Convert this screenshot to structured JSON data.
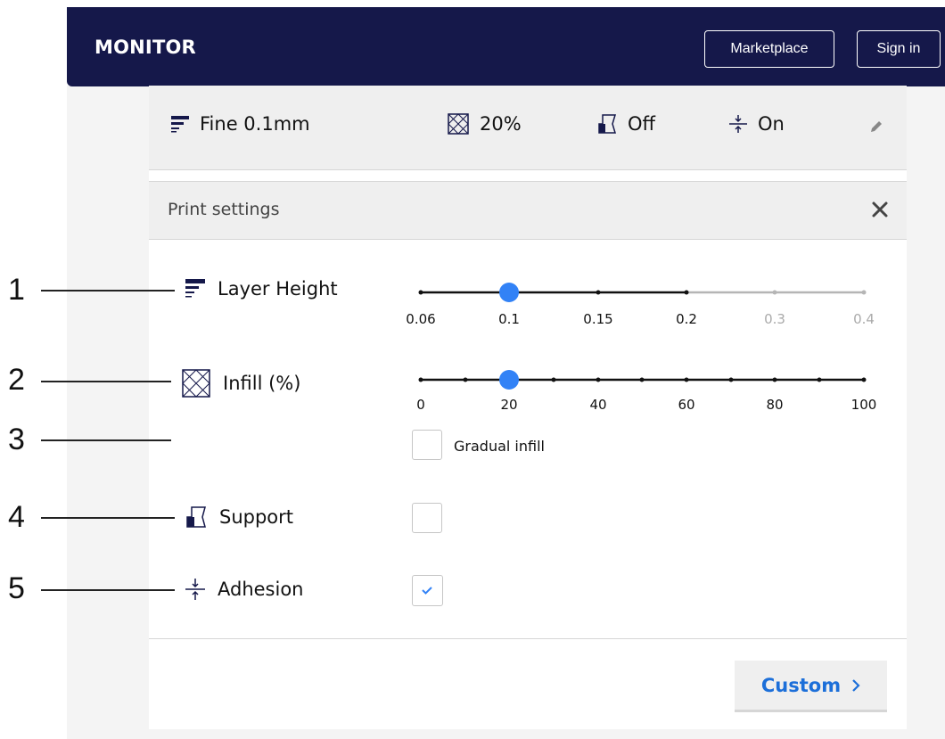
{
  "header": {
    "title": "MONITOR",
    "marketplace_label": "Marketplace",
    "signin_label": "Sign in"
  },
  "summary": {
    "layer": "Fine 0.1mm",
    "infill": "20%",
    "support": "Off",
    "adhesion": "On",
    "icons": [
      "layer-height-icon",
      "infill-icon",
      "support-icon",
      "adhesion-icon",
      "pencil-icon"
    ]
  },
  "settings": {
    "title": "Print settings",
    "close_icon": "close-icon",
    "layer_height": {
      "label": "Layer Height",
      "ticks": [
        "0.06",
        "0.1",
        "0.15",
        "0.2",
        "0.3",
        "0.4"
      ],
      "selected": "0.1",
      "enabled_up_to": "0.2"
    },
    "infill": {
      "label": "Infill (%)",
      "ticks": [
        "0",
        "20",
        "40",
        "60",
        "80",
        "100"
      ],
      "value": 20,
      "min": 0,
      "max": 100,
      "gradual_label": "Gradual infill",
      "gradual_checked": false
    },
    "support": {
      "label": "Support",
      "checked": false
    },
    "adhesion": {
      "label": "Adhesion",
      "checked": true
    },
    "custom_label": "Custom"
  },
  "callouts": [
    "1",
    "2",
    "3",
    "4",
    "5"
  ],
  "colors": {
    "header_bg": "#15184a",
    "accent": "#1c6fd9",
    "slider_handle": "#3282f6",
    "disabled": "#b5b5b5"
  }
}
